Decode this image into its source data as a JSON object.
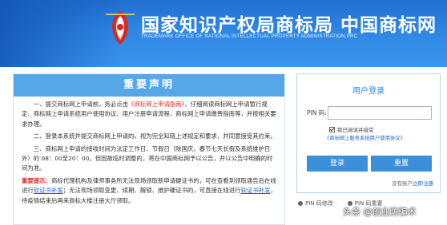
{
  "header": {
    "title_cn": "国家知识产权局商标局  中国商标网",
    "title_en": "TRADEMARK OFFICE OF NATIONAL INTELLECTUAL PROPERTY ADMINISTRATION,PRC"
  },
  "notice": {
    "heading": "重要声明",
    "p1_a": "一、提交商标网上申请前，务必点击",
    "p1_link": "《商标网上申请指南》",
    "p1_b": "，仔细阅读商标网上申请暂行规定、商标网上申请系统用户使用协议、用户注册申请流程、商标网上申请缴费指南等，并按相关要求办理。",
    "p2": "二、登录本系统并提交商标网上申请的，视为完全知晓上述规定和要求，并同意接受其约束。",
    "p3": "三、商标网上申请的接收时间为法定工作日、节假日（除国庆、春节七天长假及系统维护日外）的 08：00至20：00。但因故临时调整的，将在中国商标网予以公告，并以公告中明确的时间为准。",
    "warn_label": "重要提示：",
    "warn_a": "商标代理机构及律师事务所无法现场领取新申请硬证书的，可在查看到领取通告后在线进行",
    "warn_link1": "软证书补发",
    "warn_b": "；无法现场领取变更、续期、解锁、维护硬证书的，可直接在线进行",
    "warn_link2": "软证书补发",
    "warn_c": "，待疫情结束后再来商标大楼注册大厅领取。"
  },
  "login": {
    "title": "用户登录",
    "pin_label": "PIN 码:",
    "pin_value": "",
    "agree_text": "我已阅读并接受",
    "agree_link": "《商标网上服务系统用户使用协议》",
    "login_button": "登录",
    "reset_button": "重置",
    "register_prefix": "没有账户",
    "register_link": "立即注册"
  },
  "sub_links": {
    "pin_modify": "PIN 码修改",
    "pin_reset": "PIN 码重置"
  },
  "watermark": "头条 @创业防骗术"
}
